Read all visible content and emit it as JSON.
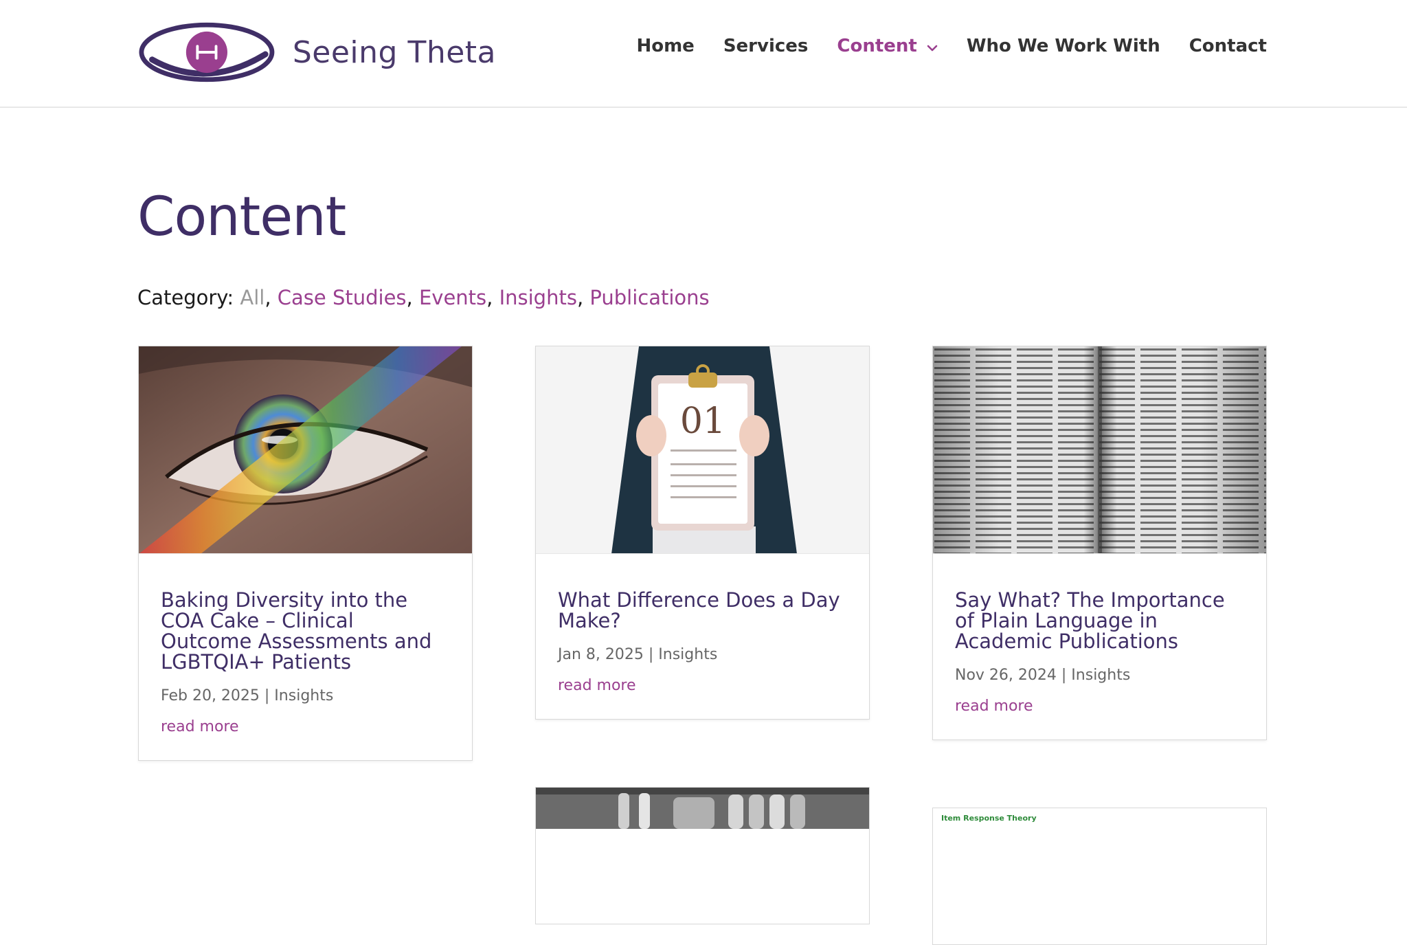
{
  "brand": {
    "name": "Seeing Theta",
    "primary_color": "#3f2e66",
    "accent_color": "#9a3f8f",
    "logo_icon": "eye-logo-icon"
  },
  "nav": {
    "items": [
      {
        "label": "Home"
      },
      {
        "label": "Services"
      },
      {
        "label": "Content",
        "active": true,
        "has_dropdown": true
      },
      {
        "label": "Who We Work With"
      },
      {
        "label": "Contact"
      }
    ]
  },
  "page": {
    "title": "Content"
  },
  "categories": {
    "prefix": "Category:",
    "items": [
      {
        "label": "All",
        "current": true
      },
      {
        "label": "Case Studies"
      },
      {
        "label": "Events"
      },
      {
        "label": "Insights"
      },
      {
        "label": "Publications"
      }
    ]
  },
  "posts": [
    {
      "title": "Baking Diversity into the COA Cake – Clinical Outcome Assessments and LGBTQIA+ Patients",
      "meta": "Feb 20, 2025 | Insights",
      "read_more": "read more",
      "image": "rainbow-eye-photo"
    },
    {
      "title": "What Difference Does a Day Make?",
      "meta": "Jan 8, 2025 | Insights",
      "read_more": "read more",
      "image": "calendar-clipboard-photo",
      "image_text": "01"
    },
    {
      "title": "Say What? The Importance of Plain Language in Academic Publications",
      "meta": "Nov 26, 2024 | Insights",
      "read_more": "read more",
      "image": "open-dictionary-photo"
    },
    {
      "image": "laboratory-glassware-photo"
    },
    {
      "image": "item-response-theory-slide",
      "image_text": "Item Response Theory"
    }
  ]
}
